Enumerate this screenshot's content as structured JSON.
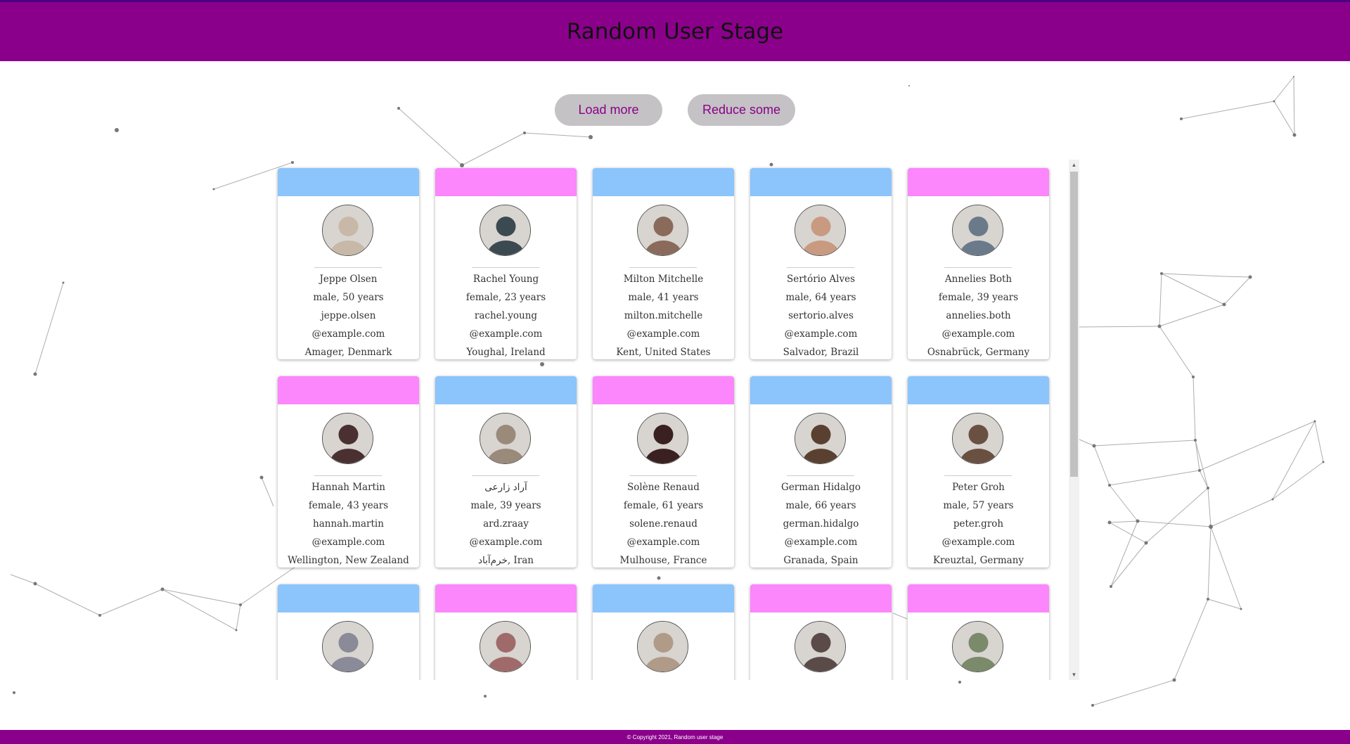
{
  "app": {
    "title": "Random User Stage"
  },
  "controls": {
    "load_more_label": "Load more",
    "reduce_some_label": "Reduce some"
  },
  "colors": {
    "header": "#8b008b",
    "male": "#8cc4fc",
    "female": "#fc86fc",
    "button_bg": "#c4c2c4",
    "button_text": "#8b008b"
  },
  "users": [
    {
      "gender": "male",
      "name": "Jeppe Olsen",
      "meta": "male, 50 years",
      "email_user": "jeppe.olsen",
      "email_domain": "@example.com",
      "location": "Amager, Denmark",
      "avatar_tone": "#c8b8a8"
    },
    {
      "gender": "female",
      "name": "Rachel Young",
      "meta": "female, 23 years",
      "email_user": "rachel.young",
      "email_domain": "@example.com",
      "location": "Youghal, Ireland",
      "avatar_tone": "#3a4a50"
    },
    {
      "gender": "male",
      "name": "Milton Mitchelle",
      "meta": "male, 41 years",
      "email_user": "milton.mitchelle",
      "email_domain": "@example.com",
      "location": "Kent, United States",
      "avatar_tone": "#8a6a5a"
    },
    {
      "gender": "male",
      "name": "Sertório Alves",
      "meta": "male, 64 years",
      "email_user": "sertorio.alves",
      "email_domain": "@example.com",
      "location": "Salvador, Brazil",
      "avatar_tone": "#c89a80"
    },
    {
      "gender": "female",
      "name": "Annelies Both",
      "meta": "female, 39 years",
      "email_user": "annelies.both",
      "email_domain": "@example.com",
      "location": "Osnabrück, Germany",
      "avatar_tone": "#6a7a8a"
    },
    {
      "gender": "female",
      "name": "Hannah Martin",
      "meta": "female, 43 years",
      "email_user": "hannah.martin",
      "email_domain": "@example.com",
      "location": "Wellington, New Zealand",
      "avatar_tone": "#4a3030"
    },
    {
      "gender": "male",
      "name": "آراد زارعی",
      "meta": "male, 39 years",
      "email_user": "ard.zraay",
      "email_domain": "@example.com",
      "location": "خرم‌آباد, Iran",
      "avatar_tone": "#9a8a7a"
    },
    {
      "gender": "female",
      "name": "Solène Renaud",
      "meta": "female, 61 years",
      "email_user": "solene.renaud",
      "email_domain": "@example.com",
      "location": "Mulhouse, France",
      "avatar_tone": "#3a2020"
    },
    {
      "gender": "male",
      "name": "German Hidalgo",
      "meta": "male, 66 years",
      "email_user": "german.hidalgo",
      "email_domain": "@example.com",
      "location": "Granada, Spain",
      "avatar_tone": "#5a4030"
    },
    {
      "gender": "male",
      "name": "Peter Groh",
      "meta": "male, 57 years",
      "email_user": "peter.groh",
      "email_domain": "@example.com",
      "location": "Kreuztal, Germany",
      "avatar_tone": "#6a5040"
    },
    {
      "gender": "male",
      "name": "",
      "meta": "",
      "email_user": "",
      "email_domain": "",
      "location": "",
      "avatar_tone": "#8a8a98"
    },
    {
      "gender": "female",
      "name": "",
      "meta": "",
      "email_user": "",
      "email_domain": "",
      "location": "",
      "avatar_tone": "#a06a6a"
    },
    {
      "gender": "male",
      "name": "",
      "meta": "",
      "email_user": "",
      "email_domain": "",
      "location": "",
      "avatar_tone": "#b09a88"
    },
    {
      "gender": "female",
      "name": "",
      "meta": "",
      "email_user": "",
      "email_domain": "",
      "location": "",
      "avatar_tone": "#5a4a48"
    },
    {
      "gender": "female",
      "name": "",
      "meta": "",
      "email_user": "",
      "email_domain": "",
      "location": "",
      "avatar_tone": "#7a8a6a"
    }
  ],
  "footer": {
    "copyright": "© Copyright 2021, Random user stage"
  }
}
